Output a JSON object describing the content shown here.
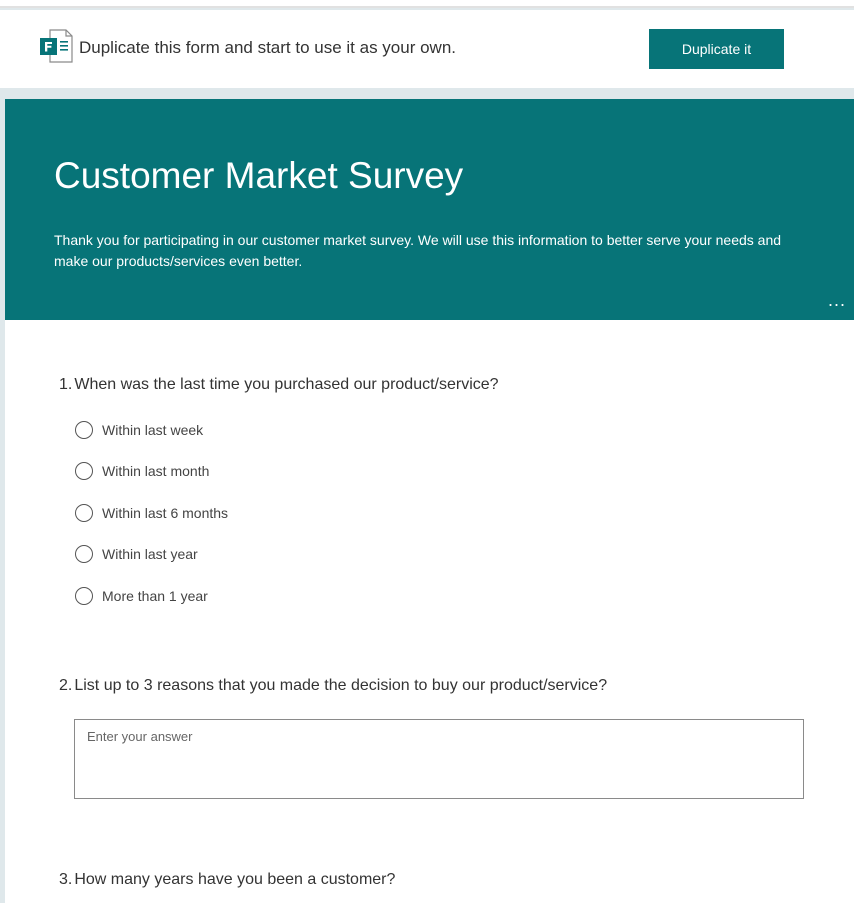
{
  "duplicate_bar": {
    "icon": "microsoft-forms-icon",
    "message": "Duplicate this form and start to use it as your own.",
    "button_label": "Duplicate it"
  },
  "form": {
    "title": "Customer Market Survey",
    "description": "Thank you for participating in our customer market survey. We will use this information to better serve your needs and make our products/services even better.",
    "more_icon": "ellipsis-icon",
    "more_text": "...",
    "questions": [
      {
        "number": "1.",
        "text": "When was the last time you purchased our product/service?",
        "type": "choice",
        "options": [
          "Within last week",
          "Within last month",
          "Within last 6 months",
          "Within last year",
          "More than 1 year"
        ]
      },
      {
        "number": "2.",
        "text": "List up to 3 reasons that you made the decision to buy our product/service?",
        "type": "text",
        "placeholder": "Enter your answer",
        "value": ""
      },
      {
        "number": "3.",
        "text": "How many years have you been a customer?"
      }
    ]
  },
  "colors": {
    "accent": "#077478",
    "page_background": "#dfe8eb",
    "card_background": "#ffffff"
  }
}
